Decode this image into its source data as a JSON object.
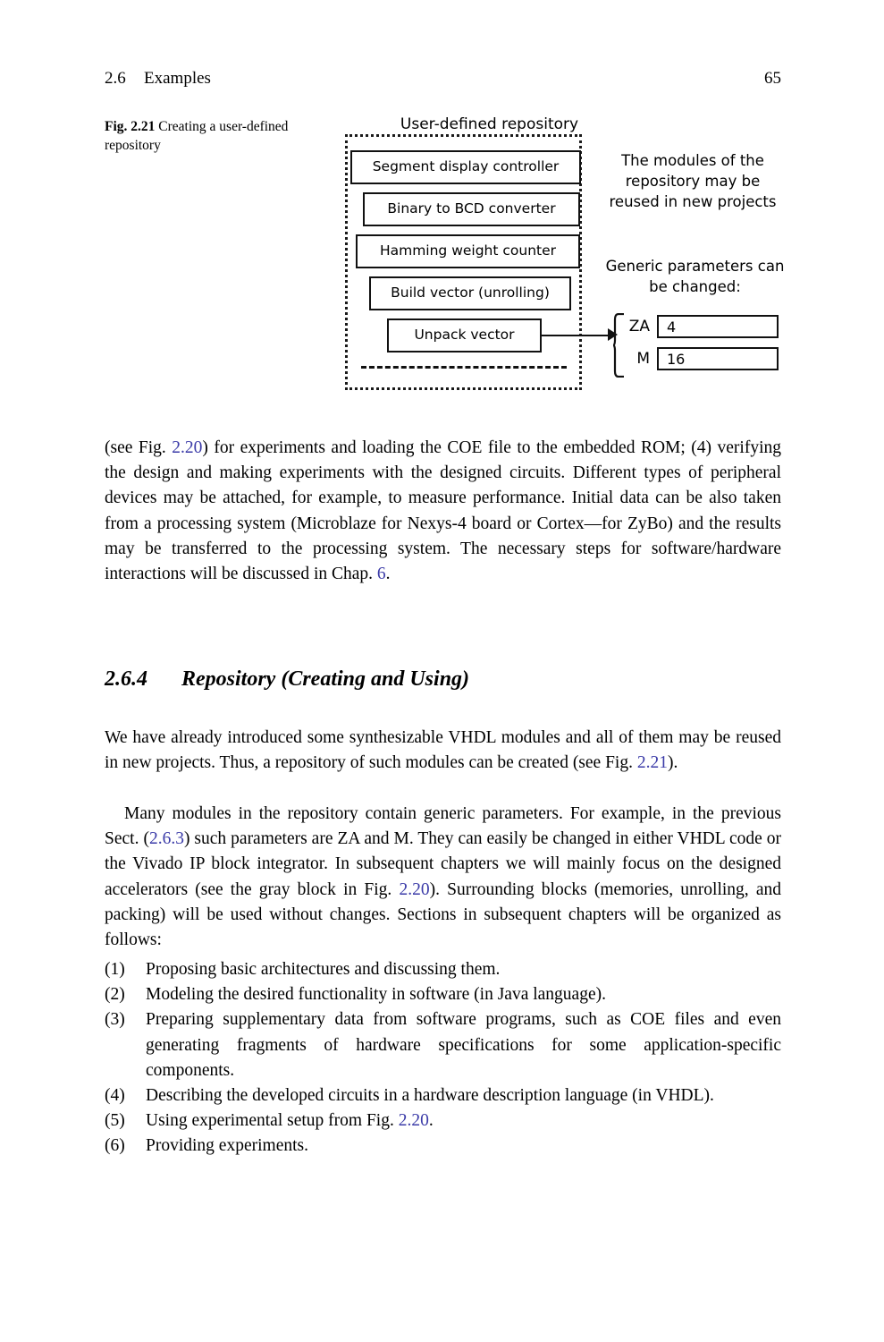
{
  "running_head": {
    "section_number": "2.6",
    "section_title": "Examples",
    "page_number": "65"
  },
  "figure": {
    "caption_label": "Fig. 2.21",
    "caption_text": "Creating a user-defined repository",
    "repository_title": "User-defined repository",
    "modules": [
      "Segment display controller",
      "Binary to BCD converter",
      "Hamming weight counter",
      "Build vector (unrolling)",
      "Unpack vector"
    ],
    "note_reuse": "The modules of the repository may be reused in new projects",
    "note_generic": "Generic parameters can be changed:",
    "parameters": [
      {
        "name": "ZA",
        "value": "4"
      },
      {
        "name": "M",
        "value": "16"
      }
    ]
  },
  "paragraphs": {
    "p1": {
      "part1": "(see Fig. ",
      "link1": "2.20",
      "part2": ") for experiments and loading the COE file to the embedded ROM; (4) verifying the design and making experiments with the designed circuits. Different types of peripheral devices may be attached, for example, to measure performance. Initial data can be also taken from a processing system (Microblaze for Nexys-4 board or Cortex—for ZyBo) and the results may be transferred to the processing system. The necessary steps for software/hardware interactions will be discussed in Chap. ",
      "link2": "6",
      "part3": "."
    },
    "p2": {
      "part1": "We have already introduced some synthesizable VHDL modules and all of them may be reused in new projects. Thus, a repository of such modules can be created (see Fig. ",
      "link1": "2.21",
      "part2": ")."
    },
    "p3": {
      "part1": "Many modules in the repository contain generic parameters. For example, in the previous Sect. (",
      "link1": "2.6.3",
      "part2": ") such parameters are ZA and M. They can easily be changed in either VHDL code or the Vivado IP block integrator. In subsequent chapters we will mainly focus on the designed accelerators (see the gray block in Fig. ",
      "link2": "2.20",
      "part3": "). Surrounding blocks (memories, unrolling, and packing) will be used without changes. Sections in subsequent chapters will be organized as follows:"
    }
  },
  "section_heading": {
    "number": "2.6.4",
    "title": "Repository (Creating and Using)"
  },
  "list_items": [
    {
      "marker": "(1)",
      "text": "Proposing basic architectures and discussing them."
    },
    {
      "marker": "(2)",
      "text": "Modeling the desired functionality in software (in Java language)."
    },
    {
      "marker": "(3)",
      "text": "Preparing supplementary data from software programs, such as COE files and even generating fragments of hardware specifications for some application-specific components."
    },
    {
      "marker": "(4)",
      "text": "Describing the developed circuits in a hardware description language (in VHDL)."
    },
    {
      "marker": "(5)",
      "text_before": "Using experimental setup from Fig. ",
      "link": "2.20",
      "text_after": "."
    },
    {
      "marker": "(6)",
      "text": "Providing experiments."
    }
  ],
  "colors": {
    "link": "#3b3ba8",
    "ink": "#000000",
    "page_background": "#ffffff"
  }
}
